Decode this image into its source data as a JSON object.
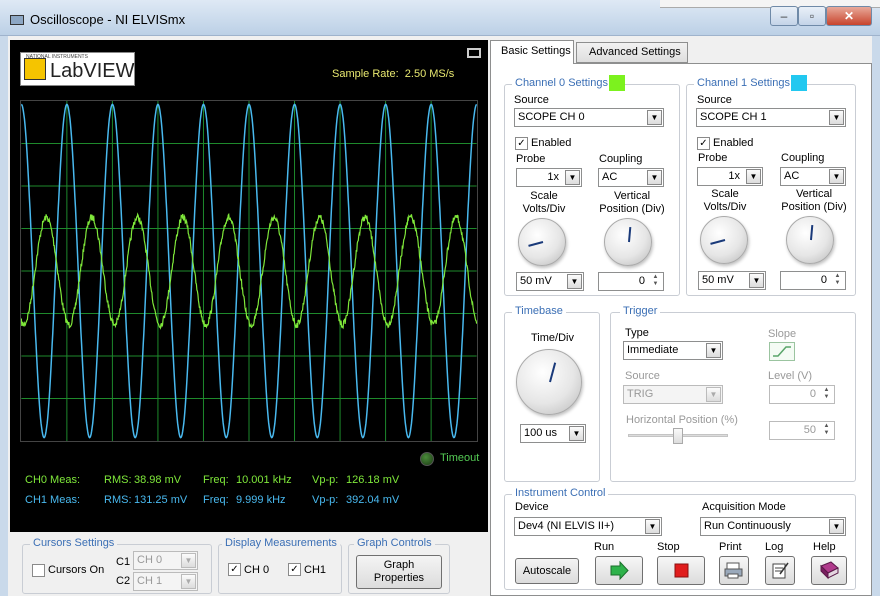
{
  "window": {
    "title": "Oscilloscope - NI ELVISmx"
  },
  "display": {
    "logo_text": "LabVIEW",
    "logo_small": "NATIONAL INSTRUMENTS",
    "sample_rate_label": "Sample Rate:",
    "sample_rate_value": "2.50 MS/s",
    "timeout_label": "Timeout",
    "measurements": [
      {
        "label": "CH0 Meas:",
        "rms_label": "RMS:",
        "rms": "38.98 mV",
        "freq_label": "Freq:",
        "freq": "10.001 kHz",
        "vpp_label": "Vp-p:",
        "vpp": "126.18 mV"
      },
      {
        "label": "CH1 Meas:",
        "rms_label": "RMS:",
        "rms": "131.25 mV",
        "freq_label": "Freq:",
        "freq": "9.999 kHz",
        "vpp_label": "Vp-p:",
        "vpp": "392.04 mV"
      }
    ]
  },
  "chart_data": {
    "type": "line",
    "title": "",
    "xlabel": "",
    "ylabel": "",
    "grid": true,
    "x_divisions": 10,
    "y_divisions": 8,
    "time_per_div_us": 100,
    "series": [
      {
        "channel": "CH 0",
        "color": "#7fe83a",
        "frequency_khz": 10.001,
        "vpp_mv": 126.18,
        "volts_per_div_mv": 50,
        "noisy": true
      },
      {
        "channel": "CH 1",
        "color": "#49b9ef",
        "frequency_khz": 9.999,
        "vpp_mv": 392.04,
        "volts_per_div_mv": 50,
        "noisy": false
      }
    ]
  },
  "cursors": {
    "group_title": "Cursors Settings",
    "cursors_on_label": "Cursors On",
    "cursors_on": false,
    "c1_label": "C1",
    "c1_value": "CH 0",
    "c2_label": "C2",
    "c2_value": "CH 1"
  },
  "display_measurements": {
    "group_title": "Display Measurements",
    "ch0_label": "CH 0",
    "ch0_checked": true,
    "ch1_label": "CH1",
    "ch1_checked": true
  },
  "graph_controls": {
    "group_title": "Graph Controls",
    "button_line1": "Graph",
    "button_line2": "Properties"
  },
  "tabs": {
    "basic": "Basic Settings",
    "advanced": "Advanced Settings"
  },
  "channels": [
    {
      "title": "Channel 0 Settings",
      "color": "#7cf21e",
      "source_label": "Source",
      "source": "SCOPE CH 0",
      "enabled_label": "Enabled",
      "enabled": true,
      "probe_label": "Probe",
      "probe": "1x",
      "coupling_label": "Coupling",
      "coupling": "AC",
      "scale_label_1": "Scale",
      "scale_label_2": "Volts/Div",
      "vpos_label_1": "Vertical",
      "vpos_label_2": "Position (Div)",
      "scale_value": "50 mV",
      "vpos_value": "0"
    },
    {
      "title": "Channel 1 Settings",
      "color": "#22c8f0",
      "source_label": "Source",
      "source": "SCOPE CH 1",
      "enabled_label": "Enabled",
      "enabled": true,
      "probe_label": "Probe",
      "probe": "1x",
      "coupling_label": "Coupling",
      "coupling": "AC",
      "scale_label_1": "Scale",
      "scale_label_2": "Volts/Div",
      "vpos_label_1": "Vertical",
      "vpos_label_2": "Position (Div)",
      "scale_value": "50 mV",
      "vpos_value": "0"
    }
  ],
  "timebase": {
    "group_title": "Timebase",
    "label": "Time/Div",
    "value": "100 us"
  },
  "trigger": {
    "group_title": "Trigger",
    "type_label": "Type",
    "type_value": "Immediate",
    "slope_label": "Slope",
    "source_label": "Source",
    "source_value": "TRIG",
    "level_label": "Level (V)",
    "level_value": "0",
    "hpos_label": "Horizontal Position (%)",
    "hpos_value": "50",
    "hpos_fraction": 0.5
  },
  "instrument_control": {
    "group_title": "Instrument Control",
    "device_label": "Device",
    "device_value": "Dev4 (NI ELVIS II+)",
    "acq_label": "Acquisition Mode",
    "acq_value": "Run Continuously",
    "autoscale_label": "Autoscale",
    "run_label": "Run",
    "stop_label": "Stop",
    "print_label": "Print",
    "log_label": "Log",
    "help_label": "Help"
  }
}
